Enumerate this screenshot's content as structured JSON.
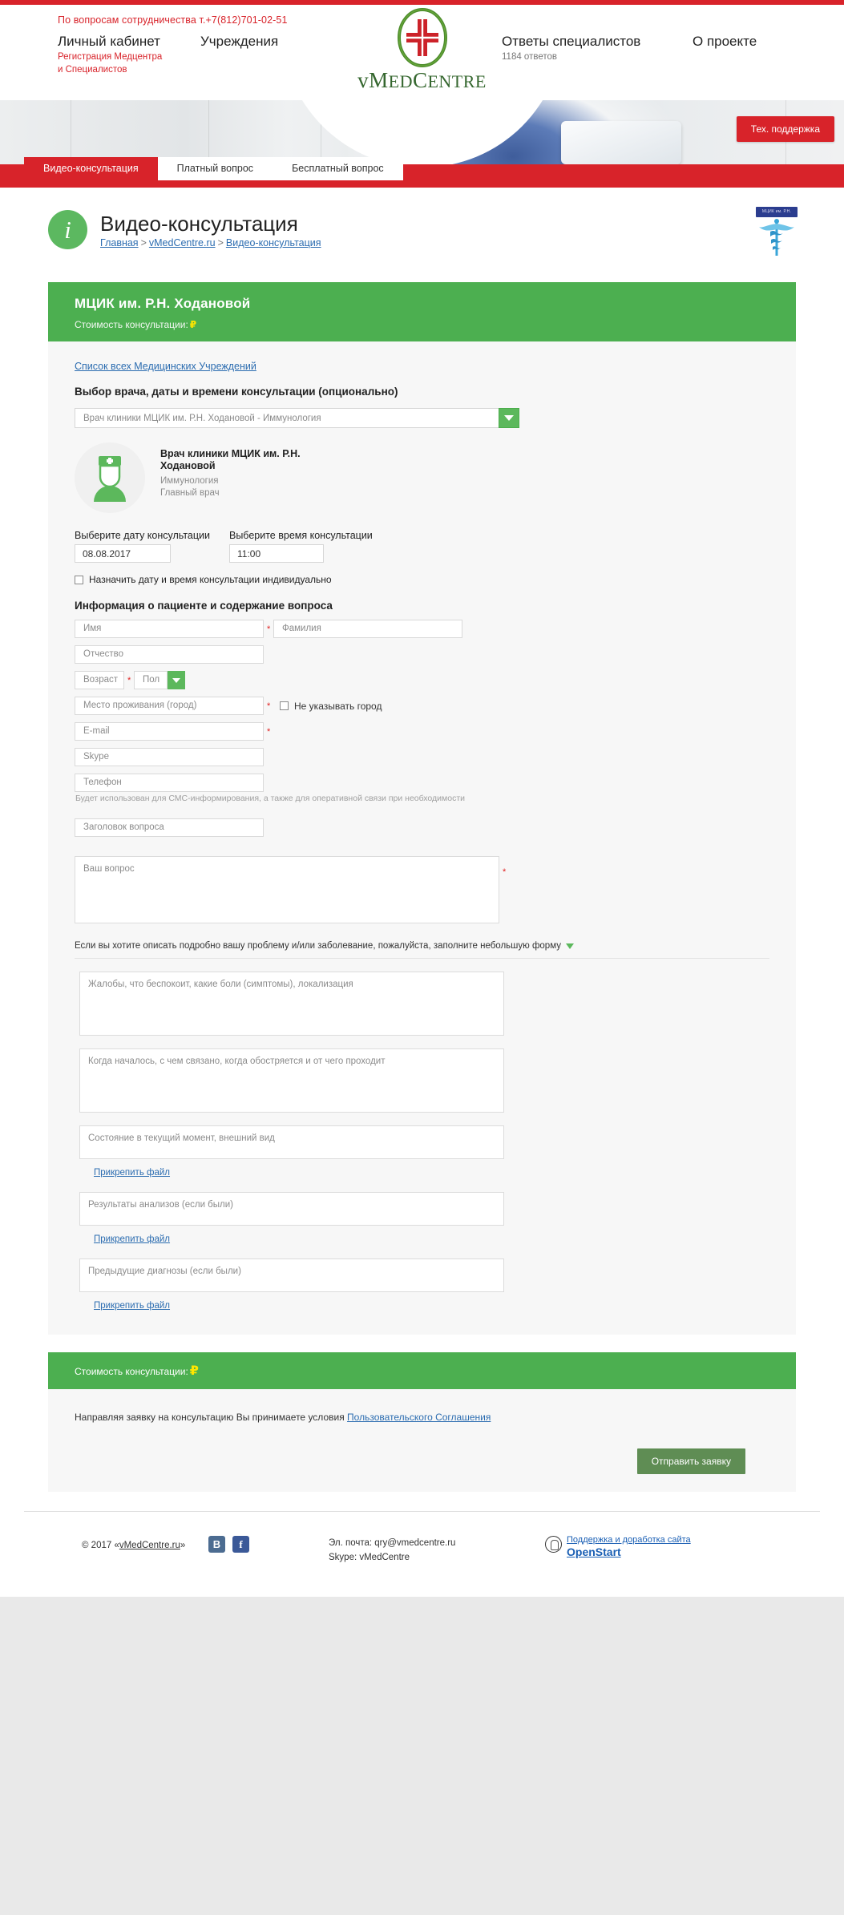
{
  "header": {
    "coop_phone": "По вопросам сотрудничества т.+7(812)701-02-51",
    "nav": [
      {
        "label": "Личный кабинет",
        "sub": "Регистрация Медцентра",
        "sub2": "и Специалистов"
      },
      {
        "label": "Учреждения"
      },
      {
        "label": "Ответы специалистов",
        "sub": "1184 ответов"
      },
      {
        "label": "О проекте"
      }
    ],
    "logo_word_v": "v",
    "logo_word_med": "M",
    "logo_word_ed": "ED",
    "logo_word_c": "C",
    "logo_word_entre": "ENTRE",
    "logo_text": "vMedCentre",
    "support_button": "Тех. поддержка"
  },
  "tabs": [
    {
      "label": "Видео-консультация",
      "active": true
    },
    {
      "label": "Платный вопрос",
      "active": false
    },
    {
      "label": "Бесплатный вопрос",
      "active": false
    }
  ],
  "page": {
    "icon": "i",
    "title": "Видео-консультация",
    "breadcrumb": [
      {
        "label": "Главная"
      },
      {
        "label": "vMedCentre.ru"
      },
      {
        "label": "Видео-консультация"
      }
    ],
    "breadcrumb_sep": ">",
    "caduceus_banner": "МЦИК им. Р.Н. Ходановой"
  },
  "clinic": {
    "name": "МЦИК им. Р.Н. Ходановой",
    "price_label": "Стоимость консультации:",
    "price_currency": "₽",
    "all_institutions_link": "Список всех Медицинских Учреждений",
    "selection_title": "Выбор врача, даты и времени консультации (опционально)",
    "doctor_select_value": "Врач клиники МЦИК им. Р.Н. Ходановой - Иммунология",
    "doctor": {
      "name": "Врач клиники МЦИК им. Р.Н. Ходановой",
      "specialty": "Иммунология",
      "role": "Главный врач"
    },
    "date_label": "Выберите дату консультации",
    "date_value": "08.08.2017",
    "time_label": "Выберите время консультации",
    "time_value": "11:00",
    "individual_checkbox": "Назначить дату и время консультации индивидуально"
  },
  "form": {
    "section_title": "Информация о пациенте и содержание вопроса",
    "first_name_ph": "Имя",
    "last_name_ph": "Фамилия",
    "middle_name_ph": "Отчество",
    "age_ph": "Возраст",
    "sex_ph": "Пол",
    "city_ph": "Место проживания (город)",
    "no_city_checkbox": "Не указывать город",
    "email_ph": "E-mail",
    "skype_ph": "Skype",
    "phone_ph": "Телефон",
    "phone_hint": "Будет использован для СМС-информирования, а также для оперативной связи при необходимости",
    "question_title_ph": "Заголовок вопроса",
    "question_ph": "Ваш вопрос",
    "required_mark": "*",
    "expand_text": "Если вы хотите описать подробно вашу проблему и/или заболевание, пожалуйста, заполните небольшую форму",
    "details": [
      {
        "placeholder": "Жалобы, что беспокоит, какие боли (симптомы), локализация",
        "attach": null
      },
      {
        "placeholder": "Когда началось, с чем связано, когда обостряется и от чего проходит",
        "attach": null
      },
      {
        "placeholder": "Состояние в текущий момент, внешний вид",
        "attach": "Прикрепить файл"
      },
      {
        "placeholder": "Результаты анализов (если были)",
        "attach": "Прикрепить файл"
      },
      {
        "placeholder": "Предыдущие диагнозы (если были)",
        "attach": "Прикрепить файл"
      }
    ]
  },
  "bottom": {
    "price_label": "Стоимость консультации:",
    "price_currency": "₽",
    "agreement_prefix": "Направляя заявку на консультацию Вы принимаете условия ",
    "agreement_link": "Пользовательского Соглашения",
    "submit_label": "Отправить заявку"
  },
  "footer": {
    "copyright_prefix": "© 2017 «",
    "copyright_link": "vMedCentre.ru",
    "copyright_suffix": "»",
    "social": [
      {
        "name": "vk",
        "glyph": "B"
      },
      {
        "name": "facebook",
        "glyph": "f"
      }
    ],
    "email_label": "Эл. почта:",
    "email_value": "qry@vmedcentre.ru",
    "skype_line": "Skype: vMedCentre",
    "support_line": "Поддержка и доработка сайта",
    "support_brand": "OpenStart"
  },
  "colors": {
    "brand_red": "#d8232a",
    "brand_green": "#4caf50",
    "accent_yellow": "#ffe600",
    "link_blue": "#2b6cb0"
  }
}
